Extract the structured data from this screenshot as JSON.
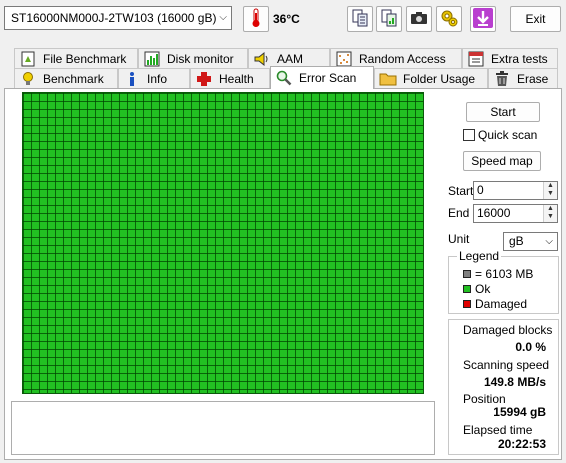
{
  "toolbar": {
    "drive": "ST16000NM000J-2TW103 (16000 gB)",
    "temperature": "36°C",
    "exit_label": "Exit"
  },
  "tabs_top": [
    {
      "label": "File Benchmark",
      "icon": "file-benchmark-icon"
    },
    {
      "label": "Disk monitor",
      "icon": "disk-monitor-icon"
    },
    {
      "label": "AAM",
      "icon": "speaker-icon"
    },
    {
      "label": "Random Access",
      "icon": "random-access-icon"
    },
    {
      "label": "Extra tests",
      "icon": "extra-tests-icon"
    }
  ],
  "tabs_bottom": [
    {
      "label": "Benchmark",
      "icon": "benchmark-icon"
    },
    {
      "label": "Info",
      "icon": "info-icon"
    },
    {
      "label": "Health",
      "icon": "health-icon"
    },
    {
      "label": "Error Scan",
      "icon": "magnifier-icon",
      "active": true
    },
    {
      "label": "Folder Usage",
      "icon": "folder-icon"
    },
    {
      "label": "Erase",
      "icon": "trash-icon"
    }
  ],
  "controls": {
    "start_label": "Start",
    "quick_scan_label": "Quick scan",
    "quick_scan_checked": false,
    "speed_map_label": "Speed map",
    "start_field_label": "Start",
    "start_value": "0",
    "end_field_label": "End",
    "end_value": "16000",
    "unit_label": "Unit",
    "unit_value": "gB"
  },
  "legend": {
    "title": "Legend",
    "items": [
      {
        "label": "= 6103 MB",
        "color": "#808080"
      },
      {
        "label": "Ok",
        "color": "#22c022"
      },
      {
        "label": "Damaged",
        "color": "#e00000"
      }
    ]
  },
  "stats": {
    "damaged_blocks_label": "Damaged blocks",
    "damaged_blocks_value": "0.0 %",
    "scanning_speed_label": "Scanning speed",
    "scanning_speed_value": "149.8 MB/s",
    "position_label": "Position",
    "position_value": "15994 gB",
    "elapsed_label": "Elapsed time",
    "elapsed_value": "20:22:53"
  },
  "colors": {
    "ok_block": "#22c022",
    "accent": "#0078d7"
  }
}
